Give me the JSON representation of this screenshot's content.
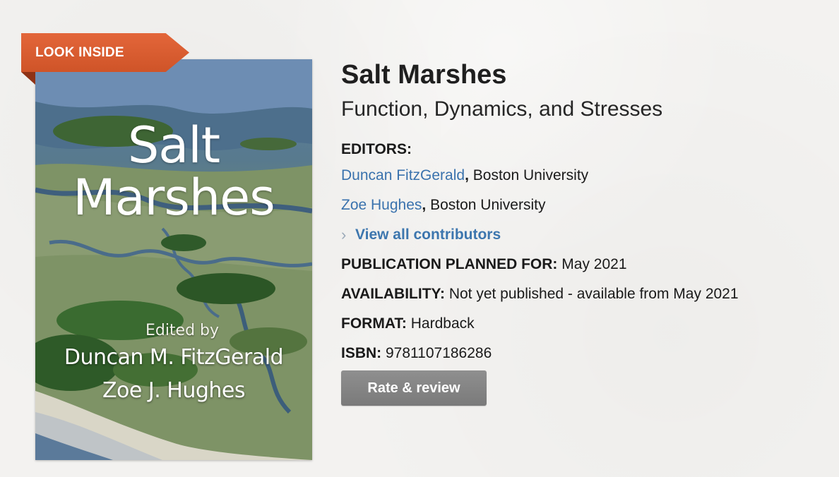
{
  "ribbon": {
    "label": "LOOK INSIDE"
  },
  "cover": {
    "title_line1": "Salt",
    "title_line2": "Marshes",
    "edited_by": "Edited by",
    "editor1": "Duncan M. FitzGerald",
    "editor2": "Zoe J. Hughes"
  },
  "book": {
    "title": "Salt Marshes",
    "subtitle": "Function, Dynamics, and Stresses"
  },
  "editors": {
    "label": "EDITORS:",
    "items": [
      {
        "name": "Duncan FitzGerald",
        "separator": ",",
        "affiliation": " Boston University"
      },
      {
        "name": "Zoe Hughes",
        "separator": ",",
        "affiliation": " Boston University"
      }
    ],
    "view_all": "View all contributors"
  },
  "meta": {
    "publication": {
      "label": "PUBLICATION PLANNED FOR:",
      "value": " May 2021"
    },
    "availability": {
      "label": "AVAILABILITY:",
      "value": " Not yet published - available from May 2021"
    },
    "format": {
      "label": "FORMAT:",
      "value": " Hardback"
    },
    "isbn": {
      "label": "ISBN:",
      "value": " 9781107186286"
    }
  },
  "actions": {
    "rate_review": "Rate & review"
  },
  "colors": {
    "ribbon": "#d9582c",
    "link": "#3a72ad",
    "button": "#858585",
    "background": "#f3f2f0"
  }
}
